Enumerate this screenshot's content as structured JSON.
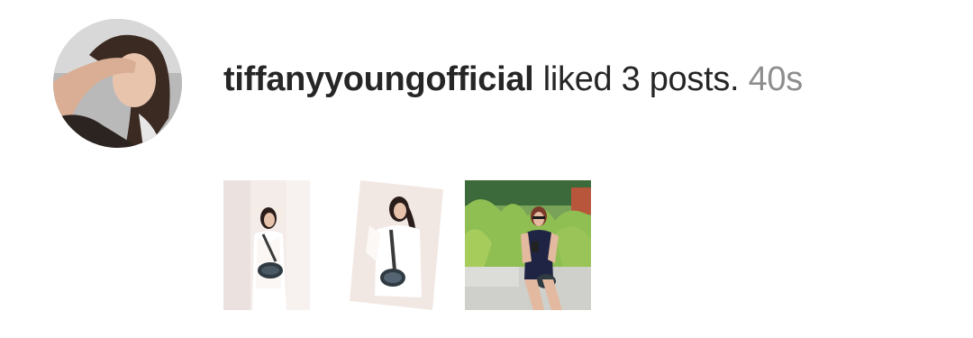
{
  "notification": {
    "username": "tiffanyyoungofficial",
    "action": "liked 3 posts.",
    "time": "40s"
  },
  "avatar": {
    "icon": "profile-photo"
  },
  "posts": [
    {
      "icon": "post-photo-white-outfit-sitting"
    },
    {
      "icon": "post-photo-white-outfit-tilted"
    },
    {
      "icon": "post-photo-black-dress-garden"
    }
  ],
  "colors": {
    "text": "#262626",
    "muted": "#8e8e8e",
    "background": "#ffffff"
  }
}
